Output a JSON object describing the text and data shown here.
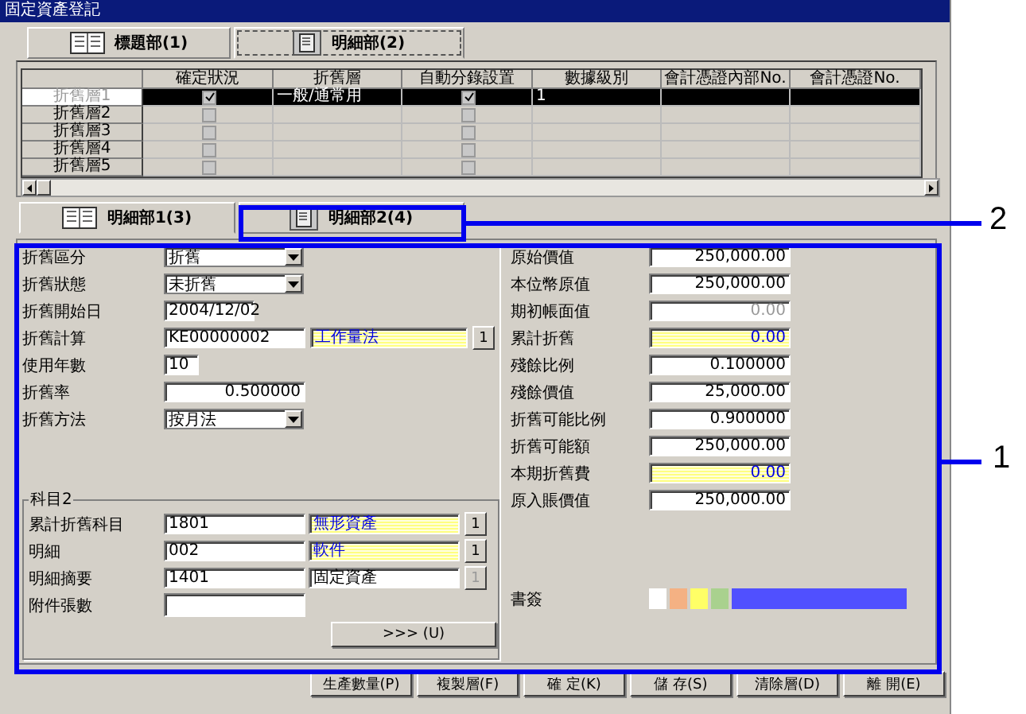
{
  "window": {
    "title": "固定資產登記"
  },
  "top_tabs": [
    {
      "label": "標題部(1)",
      "selected": false
    },
    {
      "label": "明細部(2)",
      "selected": true
    }
  ],
  "grid": {
    "columns": [
      "確定狀況",
      "折舊層",
      "自動分錄設置",
      "數據級別",
      "會計憑證內部No.",
      "會計憑證No."
    ],
    "rows": [
      {
        "header": "折舊層1",
        "selected": true,
        "confirmed": true,
        "layer": "一般/通常用",
        "auto_entry": true,
        "data_level": "1"
      },
      {
        "header": "折舊層2",
        "selected": false,
        "confirmed": false,
        "auto_entry": false
      },
      {
        "header": "折舊層3",
        "selected": false,
        "confirmed": false,
        "auto_entry": false
      },
      {
        "header": "折舊層4",
        "selected": false,
        "confirmed": false,
        "auto_entry": false
      },
      {
        "header": "折舊層5",
        "selected": false,
        "confirmed": false,
        "auto_entry": false
      }
    ]
  },
  "detail_tabs": [
    {
      "label": "明細部1(3)",
      "selected": true
    },
    {
      "label": "明細部2(4)",
      "selected": false
    }
  ],
  "left_fields": [
    {
      "label": "折舊區分",
      "kind": "select",
      "value": "折舊"
    },
    {
      "label": "折舊狀態",
      "kind": "select",
      "value": "未折舊"
    },
    {
      "label": "折舊開始日",
      "kind": "date",
      "value": "2004/12/02"
    },
    {
      "label": "折舊計算",
      "kind": "lookup",
      "value": "KE00000002",
      "name": "工作量法",
      "button": "1"
    },
    {
      "label": "使用年數",
      "kind": "short",
      "value": "10"
    },
    {
      "label": "折舊率",
      "kind": "number",
      "value": "0.500000"
    },
    {
      "label": "折舊方法",
      "kind": "select",
      "value": "按月法"
    }
  ],
  "right_fields": [
    {
      "label": "原始價值",
      "value": "250,000.00",
      "highlighted": false,
      "disabled": false
    },
    {
      "label": "本位幣原值",
      "value": "250,000.00",
      "highlighted": false,
      "disabled": false
    },
    {
      "label": "期初帳面值",
      "value": "0.00",
      "highlighted": false,
      "disabled": true
    },
    {
      "label": "累計折舊",
      "value": "0.00",
      "highlighted": true,
      "disabled": false
    },
    {
      "label": "殘餘比例",
      "value": "0.100000",
      "highlighted": false,
      "disabled": false
    },
    {
      "label": "殘餘價值",
      "value": "25,000.00",
      "highlighted": false,
      "disabled": false
    },
    {
      "label": "折舊可能比例",
      "value": "0.900000",
      "highlighted": false,
      "disabled": false
    },
    {
      "label": "折舊可能額",
      "value": "250,000.00",
      "highlighted": false,
      "disabled": false
    },
    {
      "label": "本期折舊費",
      "value": "0.00",
      "highlighted": true,
      "disabled": false
    },
    {
      "label": "原入賬價值",
      "value": "250,000.00",
      "highlighted": false,
      "disabled": false
    }
  ],
  "account_group": {
    "title": "科目2",
    "rows": [
      {
        "label": "累計折舊科目",
        "code": "1801",
        "name": "無形資產",
        "highlighted": true,
        "button": "1",
        "disabled": false
      },
      {
        "label": "明細",
        "code": "002",
        "name": "軟件",
        "highlighted": true,
        "button": "1",
        "disabled": false
      },
      {
        "label": "明細摘要",
        "code": "1401",
        "name": "固定資產",
        "highlighted": false,
        "button": "1",
        "disabled": true
      }
    ]
  },
  "attachments": {
    "label": "附件張數"
  },
  "more_button": ">>> (U)",
  "bookmarks": {
    "label": "書簽",
    "swatches": [
      {
        "color": "#ffffff"
      },
      {
        "color": "#f4b183"
      },
      {
        "color": "#ffff66"
      },
      {
        "color": "#a9d18e"
      },
      {
        "color": "#5050ff"
      }
    ]
  },
  "buttons": [
    "生產數量(P)",
    "複製層(F)",
    "確 定(K)",
    "儲 存(S)",
    "清除層(D)",
    "離 開(E)"
  ],
  "callouts": [
    {
      "label": "2"
    },
    {
      "label": "1"
    }
  ]
}
